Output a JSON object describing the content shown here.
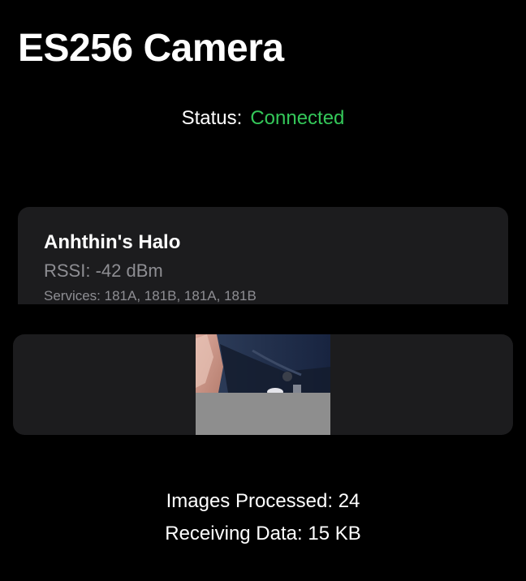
{
  "app": {
    "title": "ES256 Camera"
  },
  "status": {
    "label": "Status:",
    "value": "Connected",
    "color": "#34c759"
  },
  "device": {
    "name": "Anhthin's Halo",
    "rssi": "RSSI: -42 dBm",
    "services": "Services: 181A, 181B, 181A, 181B"
  },
  "preview": {
    "loaded_fraction": 0.58
  },
  "stats": {
    "images_processed_label": "Images Processed:",
    "images_processed_value": "24",
    "receiving_label": "Receiving Data:",
    "receiving_value": "15 KB"
  },
  "colors": {
    "background": "#000000",
    "card": "#1c1c1e",
    "secondary_text": "#8e8e93"
  }
}
